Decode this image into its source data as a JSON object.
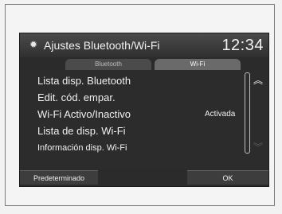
{
  "header": {
    "icon": "gear-icon",
    "title": "Ajustes Bluetooth/Wi-Fi",
    "clock": "12:34"
  },
  "tabs": [
    {
      "label": "Bluetooth",
      "active": false
    },
    {
      "label": "Wi-Fi",
      "active": true
    }
  ],
  "menu": {
    "items": [
      {
        "label": "Lista disp. Bluetooth",
        "value": ""
      },
      {
        "label": "Edit. cód. empar.",
        "value": ""
      },
      {
        "label": "Wi-Fi Activo/Inactivo",
        "value": "Activada"
      },
      {
        "label": "Lista de disp. Wi-Fi",
        "value": ""
      },
      {
        "label": "Información disp. Wi-Fi",
        "value": ""
      }
    ]
  },
  "footer": {
    "default_label": "Predeterminado",
    "ok_label": "OK"
  },
  "colors": {
    "screen_bg": "#2c2c2c",
    "active_tab": "#6a6a6a",
    "text": "#f0f0f0"
  }
}
